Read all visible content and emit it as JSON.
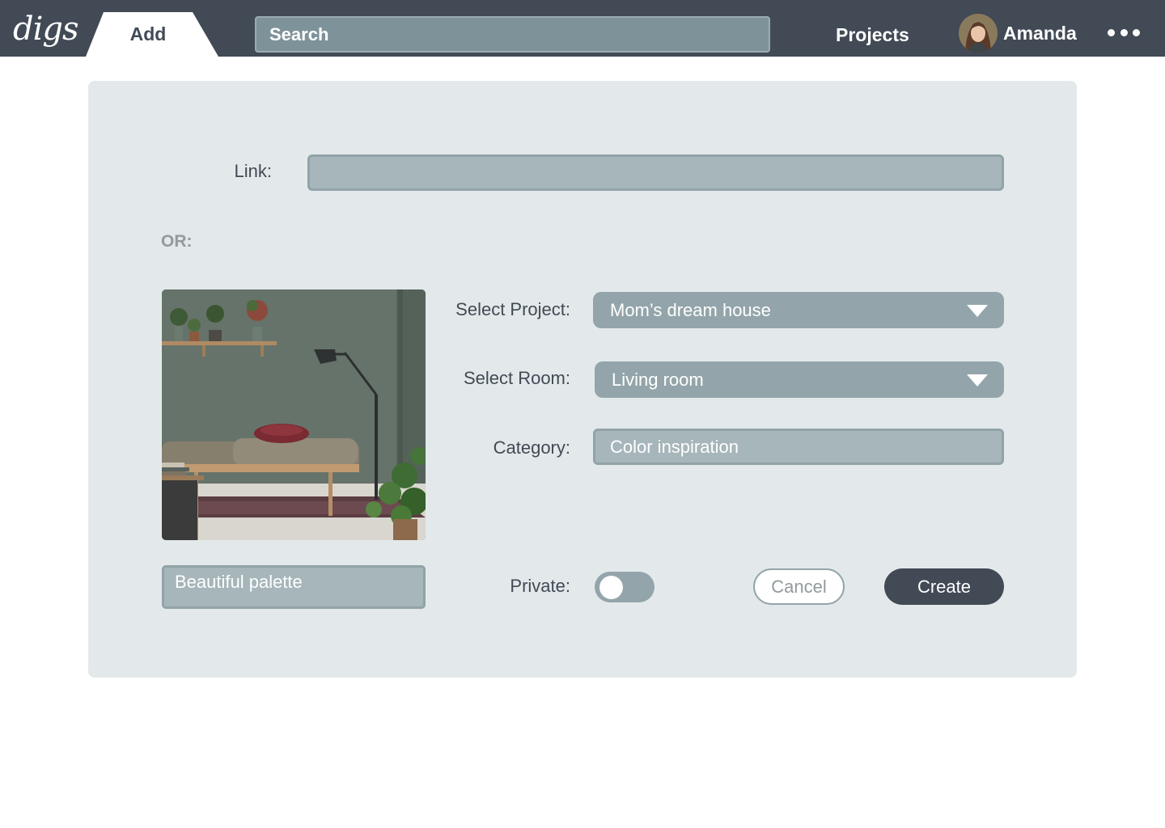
{
  "header": {
    "logo_text": "digs",
    "active_tab_label": "Add",
    "search_placeholder": "Search",
    "projects_label": "Projects",
    "user_name": "Amanda",
    "more_icon": "more-horizontal-icon"
  },
  "form": {
    "link_label": "Link:",
    "link_value": "",
    "or_label": "OR:",
    "project_label": "Select Project:",
    "project_value": "Mom’s dream house",
    "room_label": "Select Room:",
    "room_value": "Living room",
    "category_label": "Category:",
    "category_value": "Color inspiration",
    "caption_value": "Beautiful palette",
    "private_label": "Private:",
    "private_on": false,
    "cancel_label": "Cancel",
    "create_label": "Create"
  },
  "colors": {
    "topbar": "#414a55",
    "card": "#e3e9ea",
    "field": "#93a5aa",
    "primary_button": "#414a55"
  }
}
